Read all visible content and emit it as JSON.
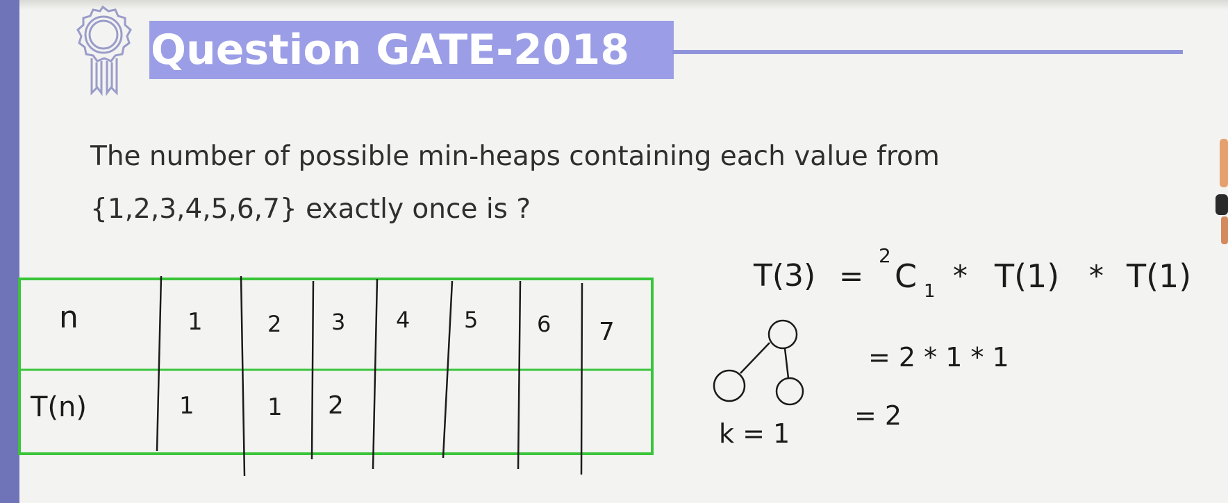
{
  "header": {
    "title": "Question GATE-2018",
    "accent_color": "#9b9ee6",
    "icon": "award-ribbon-icon"
  },
  "question": {
    "line1": "The number of possible min-heaps containing each value from",
    "line2": "{1,2,3,4,5,6,7} exactly once is ?"
  },
  "table": {
    "border_color": "#39c43a",
    "row_headers": [
      "n",
      "T(n)"
    ],
    "n_values": [
      "1",
      "2",
      "3",
      "4",
      "5",
      "6",
      "7"
    ],
    "t_values": [
      "1",
      "1",
      "2",
      "",
      "",
      "",
      ""
    ]
  },
  "work": {
    "line1_lhs": "T(3)",
    "eq": "=",
    "sup": "2",
    "c": "C",
    "sub": "1",
    "star": "*",
    "t1a": "T(1)",
    "t1b": "T(1)",
    "line2": "= 2 * 1 * 1",
    "line3": "= 2",
    "k_label": "k = 1"
  }
}
